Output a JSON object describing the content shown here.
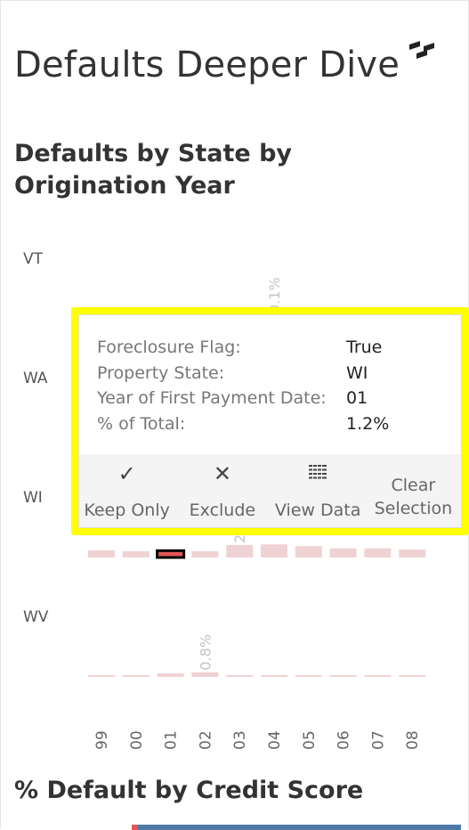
{
  "dashboard": {
    "title": "Defaults Deeper Dive",
    "logo_icon": "tableau-style-logo"
  },
  "chart_section": {
    "title_line1": "Defaults by State by",
    "title_line2": "Origination Year"
  },
  "chart_data": {
    "type": "bar",
    "title": "Defaults by State by Origination Year",
    "row_labels": [
      "VT",
      "WA",
      "WI",
      "WV"
    ],
    "categories": [
      "99",
      "00",
      "01",
      "02",
      "03",
      "04",
      "05",
      "06",
      "07",
      "08"
    ],
    "series": [
      {
        "name": "WI",
        "values": [
          1.25,
          1.1,
          1.2,
          1.1,
          2.2,
          2.3,
          2.0,
          1.6,
          1.6,
          1.4
        ]
      },
      {
        "name": "WV",
        "values": [
          0.1,
          0.3,
          0.6,
          0.8,
          0.1,
          0.1,
          0.1,
          0.1,
          0.1,
          0.1
        ]
      }
    ],
    "data_labels": [
      {
        "row": "WA",
        "category": "04",
        "text": "0.1%"
      },
      {
        "row": "WI",
        "category": "03",
        "text": "2.2%"
      },
      {
        "row": "WV",
        "category": "02",
        "text": "0.8%"
      }
    ],
    "selected": {
      "row": "WI",
      "category": "01"
    },
    "unit": "%",
    "colors": {
      "bar": "#efd3d4",
      "selected": "#e15759"
    }
  },
  "tooltip": {
    "fields": [
      {
        "label": "Foreclosure Flag:",
        "value": "True"
      },
      {
        "label": "Property State:",
        "value": "WI"
      },
      {
        "label": "Year of First Payment Date:",
        "value": "01"
      },
      {
        "label": "% of Total:",
        "value": "1.2%"
      }
    ],
    "actions": [
      {
        "label": "Keep Only",
        "icon": "check-icon"
      },
      {
        "label": "Exclude",
        "icon": "x-icon"
      },
      {
        "label": "View Data",
        "icon": "grid-icon"
      },
      {
        "label": "Clear Selection",
        "line1": "Clear",
        "line2": "Selection"
      }
    ],
    "highlight_color": "#ffff00"
  },
  "credit_section": {
    "title": "% Default by Credit Score",
    "colors": {
      "bar": "#4e79a7",
      "accent": "#e15759"
    }
  }
}
